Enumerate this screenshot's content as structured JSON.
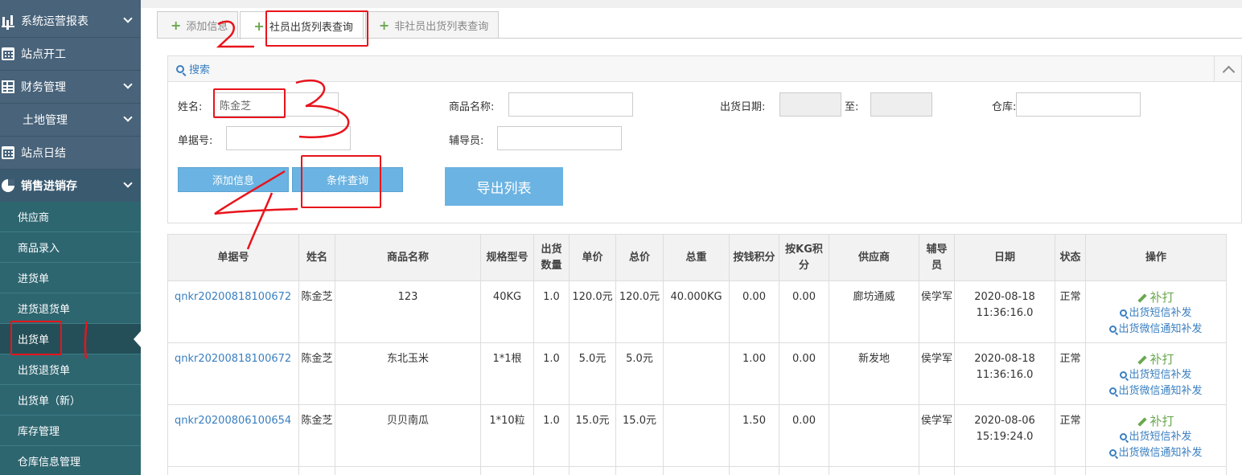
{
  "sidebar": {
    "items": [
      {
        "label": "系统运营报表",
        "icon": "bar-chart-icon"
      },
      {
        "label": "站点开工",
        "icon": "calendar-icon"
      },
      {
        "label": "财务管理",
        "icon": "table-icon"
      },
      {
        "label": "土地管理",
        "icon": ""
      },
      {
        "label": "站点日结",
        "icon": "calendar-icon"
      },
      {
        "label": "销售进销存",
        "icon": "pie-chart-icon"
      }
    ],
    "subitems": [
      {
        "label": "供应商"
      },
      {
        "label": "商品录入"
      },
      {
        "label": "进货单"
      },
      {
        "label": "进货退货单"
      },
      {
        "label": "出货单"
      },
      {
        "label": "出货退货单"
      },
      {
        "label": "出货单（新）"
      },
      {
        "label": "库存管理"
      },
      {
        "label": "仓库信息管理"
      }
    ]
  },
  "tabs": [
    {
      "label": "添加信息"
    },
    {
      "label": "社员出货列表查询"
    },
    {
      "label": "非社员出货列表查询"
    }
  ],
  "search": {
    "title": "搜索",
    "name_label": "姓名:",
    "name_value": "陈金芝",
    "product_label": "商品名称:",
    "date_label": "出货日期:",
    "to_label": "至:",
    "warehouse_label": "仓库:",
    "doc_label": "单据号:",
    "guide_label": "辅导员:",
    "add_button": "添加信息",
    "query_button": "条件查询",
    "export_button": "导出列表"
  },
  "table": {
    "headers": [
      "单据号",
      "姓名",
      "商品名称",
      "规格型号",
      "出货数量",
      "单价",
      "总价",
      "总重",
      "按钱积分",
      "按KG积分",
      "供应商",
      "辅导员",
      "日期",
      "状态",
      "操作"
    ],
    "rows": [
      {
        "doc": "qnkr20200818100672",
        "name": "陈金芝",
        "product": "123",
        "spec": "40KG",
        "qty": "1.0",
        "price": "120.0元",
        "total": "120.0元",
        "weight": "40.000KG",
        "money_pts": "0.00",
        "kg_pts": "0.00",
        "supplier": "廊坊通威",
        "guide": "侯学军",
        "date": "2020-08-18",
        "time": "11:36:16.0",
        "status": "正常"
      },
      {
        "doc": "qnkr20200818100672",
        "name": "陈金芝",
        "product": "东北玉米",
        "spec": "1*1根",
        "qty": "1.0",
        "price": "5.0元",
        "total": "5.0元",
        "weight": "",
        "money_pts": "1.00",
        "kg_pts": "0.00",
        "supplier": "新发地",
        "guide": "侯学军",
        "date": "2020-08-18",
        "time": "11:36:16.0",
        "status": "正常"
      },
      {
        "doc": "qnkr20200806100654",
        "name": "陈金芝",
        "product": "贝贝南瓜",
        "spec": "1*10粒",
        "qty": "1.0",
        "price": "15.0元",
        "total": "15.0元",
        "weight": "",
        "money_pts": "1.50",
        "kg_pts": "0.00",
        "supplier": "",
        "guide": "侯学军",
        "date": "2020-08-06",
        "time": "15:19:24.0",
        "status": "正常"
      }
    ],
    "actions": {
      "reprint": "补打",
      "sms": "出货短信补发",
      "wechat": "出货微信通知补发"
    }
  },
  "annotations": {
    "n2": "2",
    "n3": "3",
    "n4": "4"
  },
  "colors": {
    "sidebar_dark": "#2f4f63",
    "accent_blue": "#6bb3e2",
    "link_blue": "#3a7fc0",
    "green": "#6aa84f",
    "annotation_red": "#e8141c"
  }
}
